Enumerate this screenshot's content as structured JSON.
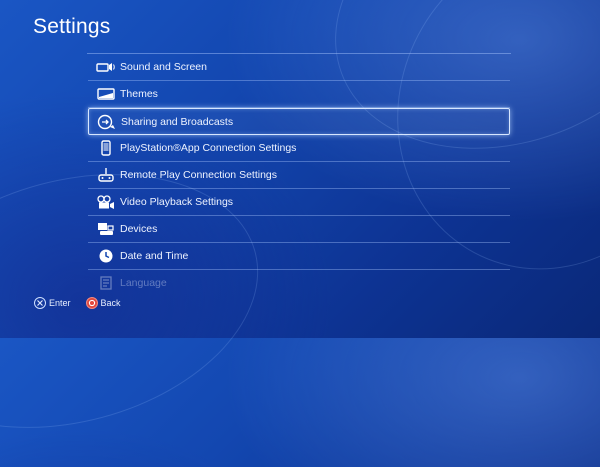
{
  "title": "Settings",
  "menu": {
    "items": [
      {
        "label": "Sound and Screen",
        "icon": "sound-screen-icon"
      },
      {
        "label": "Themes",
        "icon": "themes-icon"
      },
      {
        "label": "Sharing and Broadcasts",
        "icon": "sharing-icon",
        "selected": true
      },
      {
        "label": "PlayStation®App Connection Settings",
        "icon": "phone-icon"
      },
      {
        "label": "Remote Play Connection Settings",
        "icon": "remote-play-icon"
      },
      {
        "label": "Video Playback Settings",
        "icon": "video-playback-icon"
      },
      {
        "label": "Devices",
        "icon": "devices-icon"
      },
      {
        "label": "Date and Time",
        "icon": "clock-icon"
      },
      {
        "label": "Language",
        "icon": "language-icon"
      }
    ]
  },
  "footer": {
    "enter_label": "Enter",
    "back_label": "Back"
  },
  "colors": {
    "background": "#1347b0",
    "circle_button": "#e0483e",
    "highlight_border": "#d6e6ff"
  }
}
